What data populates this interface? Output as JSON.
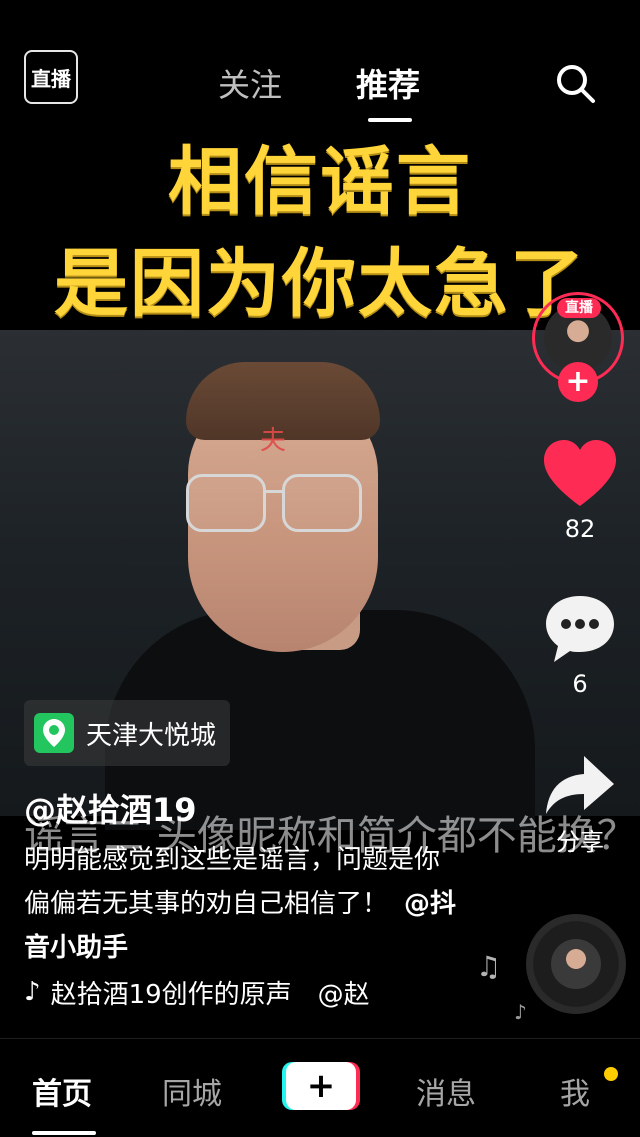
{
  "top_nav": {
    "live_label": "直播",
    "tabs": [
      {
        "label": "关注",
        "active": false
      },
      {
        "label": "推荐",
        "active": true
      }
    ]
  },
  "video": {
    "title_line1": "相信谣言",
    "title_line2": "是因为你太急了",
    "forehead_char": "夫",
    "subtitle": "谣言二 头像昵称和简介都不能换？"
  },
  "rail": {
    "avatar_live_badge": "直播",
    "follow_symbol": "+",
    "like_count": "82",
    "comment_count": "6",
    "share_label": "分享",
    "accent_color": "#fe2c55"
  },
  "info": {
    "location": "天津大悦城",
    "author": "@赵拾酒19",
    "description": "明明能感觉到这些是谣言，问题是你偏偏若无其事的劝自己相信了！",
    "mention": "@抖音小助手",
    "music_text": "赵拾酒19创作的原声　@赵"
  },
  "bottom_nav": {
    "home": "首页",
    "city": "同城",
    "create": "+",
    "messages": "消息",
    "me": "我"
  },
  "icons": [
    "live-icon",
    "search-icon",
    "heart-icon",
    "comment-icon",
    "share-icon",
    "location-pin-icon",
    "music-note-icon",
    "music-disc-icon"
  ]
}
